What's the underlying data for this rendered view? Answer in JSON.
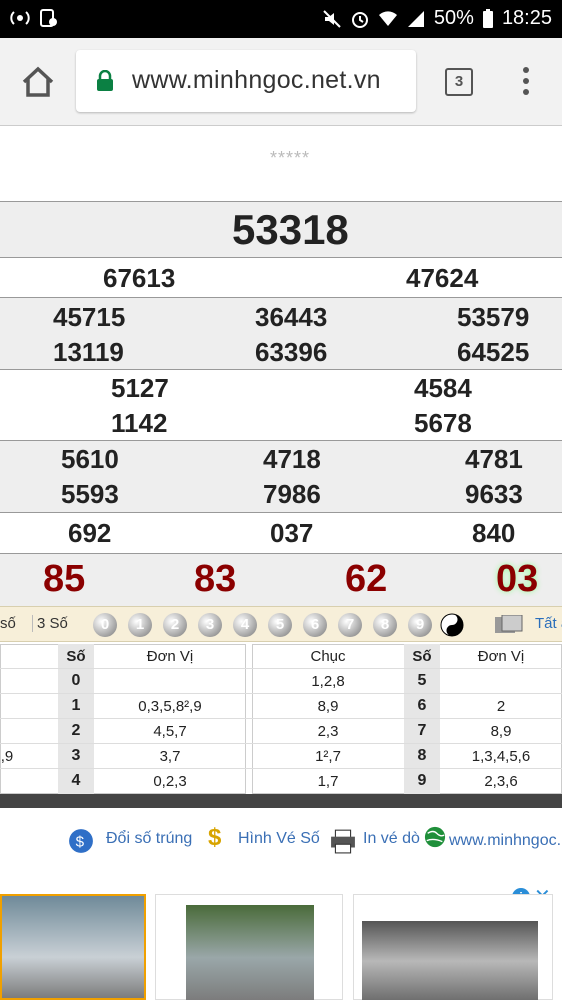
{
  "status_bar": {
    "battery": "50%",
    "time": "18:25"
  },
  "browser": {
    "url": "www.minhngoc.net.vn",
    "tab_count": "3"
  },
  "stars": "*****",
  "special_prize": "53318",
  "prize_1": [
    "67613",
    "47624"
  ],
  "prize_2": [
    "45715",
    "36443",
    "53579",
    "13119",
    "63396",
    "64525"
  ],
  "prize_3": [
    "5127",
    "4584",
    "1142",
    "5678"
  ],
  "prize_4": [
    "5610",
    "4718",
    "4781",
    "5593",
    "7986",
    "9633"
  ],
  "prize_5": [
    "692",
    "037",
    "840"
  ],
  "prize_6": [
    "85",
    "83",
    "62",
    "03"
  ],
  "ball_bar": {
    "left_tabs": [
      "số",
      "3 Số"
    ],
    "balls": [
      "0",
      "1",
      "2",
      "3",
      "4",
      "5",
      "6",
      "7",
      "8",
      "9"
    ],
    "all_label": "Tất a"
  },
  "table": {
    "left_headers": [
      "Số",
      "Đơn Vị"
    ],
    "right_headers": [
      "Chục",
      "Số",
      "Đơn Vị"
    ],
    "left_rows": [
      {
        "chuc": "",
        "so": "0",
        "don_vi": ""
      },
      {
        "chuc": "",
        "so": "1",
        "don_vi": "0,3,5,8²,9"
      },
      {
        "chuc": "",
        "so": "2",
        "don_vi": "4,5,7"
      },
      {
        "chuc": ",9",
        "so": "3",
        "don_vi": "3,7"
      },
      {
        "chuc": "",
        "so": "4",
        "don_vi": "0,2,3"
      }
    ],
    "right_rows": [
      {
        "chuc": "1,2,8",
        "so": "5",
        "don_vi": ""
      },
      {
        "chuc": "8,9",
        "so": "6",
        "don_vi": "2"
      },
      {
        "chuc": "2,3",
        "so": "7",
        "don_vi": "8,9"
      },
      {
        "chuc": "1²,7",
        "so": "8",
        "don_vi": "1,3,4,5,6"
      },
      {
        "chuc": "1,7",
        "so": "9",
        "don_vi": "2,3,6"
      }
    ]
  },
  "footer_links": [
    "Đổi số trúng",
    "Hình Vé Số",
    "In vé dò",
    "www.minhngoc."
  ]
}
